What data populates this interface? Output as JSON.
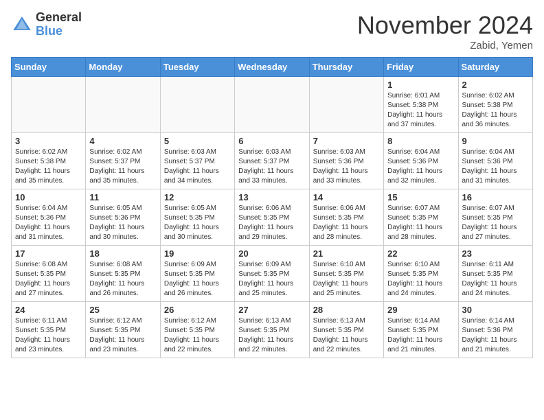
{
  "header": {
    "logo_general": "General",
    "logo_blue": "Blue",
    "month_title": "November 2024",
    "location": "Zabid, Yemen"
  },
  "weekdays": [
    "Sunday",
    "Monday",
    "Tuesday",
    "Wednesday",
    "Thursday",
    "Friday",
    "Saturday"
  ],
  "weeks": [
    [
      {
        "day": "",
        "info": ""
      },
      {
        "day": "",
        "info": ""
      },
      {
        "day": "",
        "info": ""
      },
      {
        "day": "",
        "info": ""
      },
      {
        "day": "",
        "info": ""
      },
      {
        "day": "1",
        "info": "Sunrise: 6:01 AM\nSunset: 5:38 PM\nDaylight: 11 hours\nand 37 minutes."
      },
      {
        "day": "2",
        "info": "Sunrise: 6:02 AM\nSunset: 5:38 PM\nDaylight: 11 hours\nand 36 minutes."
      }
    ],
    [
      {
        "day": "3",
        "info": "Sunrise: 6:02 AM\nSunset: 5:38 PM\nDaylight: 11 hours\nand 35 minutes."
      },
      {
        "day": "4",
        "info": "Sunrise: 6:02 AM\nSunset: 5:37 PM\nDaylight: 11 hours\nand 35 minutes."
      },
      {
        "day": "5",
        "info": "Sunrise: 6:03 AM\nSunset: 5:37 PM\nDaylight: 11 hours\nand 34 minutes."
      },
      {
        "day": "6",
        "info": "Sunrise: 6:03 AM\nSunset: 5:37 PM\nDaylight: 11 hours\nand 33 minutes."
      },
      {
        "day": "7",
        "info": "Sunrise: 6:03 AM\nSunset: 5:36 PM\nDaylight: 11 hours\nand 33 minutes."
      },
      {
        "day": "8",
        "info": "Sunrise: 6:04 AM\nSunset: 5:36 PM\nDaylight: 11 hours\nand 32 minutes."
      },
      {
        "day": "9",
        "info": "Sunrise: 6:04 AM\nSunset: 5:36 PM\nDaylight: 11 hours\nand 31 minutes."
      }
    ],
    [
      {
        "day": "10",
        "info": "Sunrise: 6:04 AM\nSunset: 5:36 PM\nDaylight: 11 hours\nand 31 minutes."
      },
      {
        "day": "11",
        "info": "Sunrise: 6:05 AM\nSunset: 5:36 PM\nDaylight: 11 hours\nand 30 minutes."
      },
      {
        "day": "12",
        "info": "Sunrise: 6:05 AM\nSunset: 5:35 PM\nDaylight: 11 hours\nand 30 minutes."
      },
      {
        "day": "13",
        "info": "Sunrise: 6:06 AM\nSunset: 5:35 PM\nDaylight: 11 hours\nand 29 minutes."
      },
      {
        "day": "14",
        "info": "Sunrise: 6:06 AM\nSunset: 5:35 PM\nDaylight: 11 hours\nand 28 minutes."
      },
      {
        "day": "15",
        "info": "Sunrise: 6:07 AM\nSunset: 5:35 PM\nDaylight: 11 hours\nand 28 minutes."
      },
      {
        "day": "16",
        "info": "Sunrise: 6:07 AM\nSunset: 5:35 PM\nDaylight: 11 hours\nand 27 minutes."
      }
    ],
    [
      {
        "day": "17",
        "info": "Sunrise: 6:08 AM\nSunset: 5:35 PM\nDaylight: 11 hours\nand 27 minutes."
      },
      {
        "day": "18",
        "info": "Sunrise: 6:08 AM\nSunset: 5:35 PM\nDaylight: 11 hours\nand 26 minutes."
      },
      {
        "day": "19",
        "info": "Sunrise: 6:09 AM\nSunset: 5:35 PM\nDaylight: 11 hours\nand 26 minutes."
      },
      {
        "day": "20",
        "info": "Sunrise: 6:09 AM\nSunset: 5:35 PM\nDaylight: 11 hours\nand 25 minutes."
      },
      {
        "day": "21",
        "info": "Sunrise: 6:10 AM\nSunset: 5:35 PM\nDaylight: 11 hours\nand 25 minutes."
      },
      {
        "day": "22",
        "info": "Sunrise: 6:10 AM\nSunset: 5:35 PM\nDaylight: 11 hours\nand 24 minutes."
      },
      {
        "day": "23",
        "info": "Sunrise: 6:11 AM\nSunset: 5:35 PM\nDaylight: 11 hours\nand 24 minutes."
      }
    ],
    [
      {
        "day": "24",
        "info": "Sunrise: 6:11 AM\nSunset: 5:35 PM\nDaylight: 11 hours\nand 23 minutes."
      },
      {
        "day": "25",
        "info": "Sunrise: 6:12 AM\nSunset: 5:35 PM\nDaylight: 11 hours\nand 23 minutes."
      },
      {
        "day": "26",
        "info": "Sunrise: 6:12 AM\nSunset: 5:35 PM\nDaylight: 11 hours\nand 22 minutes."
      },
      {
        "day": "27",
        "info": "Sunrise: 6:13 AM\nSunset: 5:35 PM\nDaylight: 11 hours\nand 22 minutes."
      },
      {
        "day": "28",
        "info": "Sunrise: 6:13 AM\nSunset: 5:35 PM\nDaylight: 11 hours\nand 22 minutes."
      },
      {
        "day": "29",
        "info": "Sunrise: 6:14 AM\nSunset: 5:35 PM\nDaylight: 11 hours\nand 21 minutes."
      },
      {
        "day": "30",
        "info": "Sunrise: 6:14 AM\nSunset: 5:36 PM\nDaylight: 11 hours\nand 21 minutes."
      }
    ]
  ]
}
